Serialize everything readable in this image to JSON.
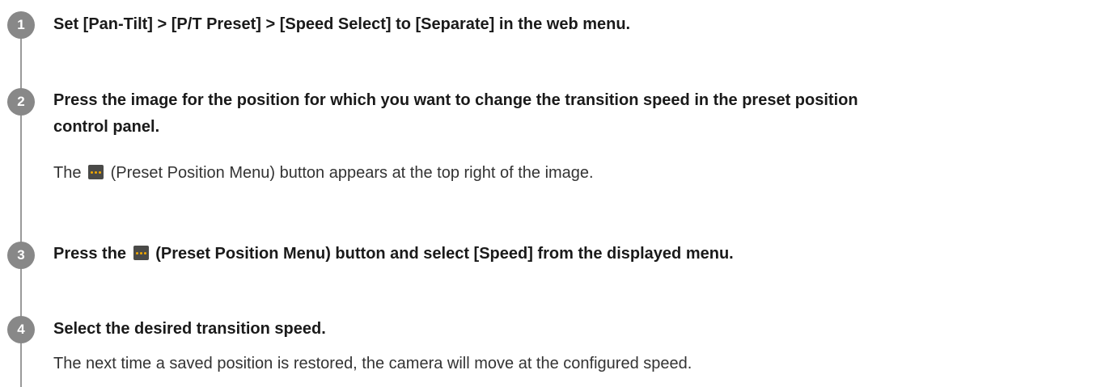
{
  "steps": [
    {
      "number": "1",
      "title": "Set [Pan-Tilt] > [P/T Preset] > [Speed Select] to [Separate] in the web menu."
    },
    {
      "number": "2",
      "title_line1": "Press the image for the position for which you want to change the transition speed in the preset position",
      "title_line2": "control panel.",
      "desc_before_icon": "The",
      "icon": "preset-position-menu-icon",
      "desc_after_icon": "(Preset Position Menu) button appears at the top right of the image."
    },
    {
      "number": "3",
      "title_before_icon": "Press the",
      "icon": "preset-position-menu-icon",
      "title_after_icon": "(Preset Position Menu) button and select [Speed] from the displayed menu."
    },
    {
      "number": "4",
      "title": "Select the desired transition speed.",
      "desc": "The next time a saved position is restored, the camera will move at the configured speed."
    }
  ],
  "colors": {
    "step_circle": "#888888",
    "timeline": "#9a9a9a",
    "icon_background": "#4a4a48",
    "icon_dots": "#f2a900"
  }
}
